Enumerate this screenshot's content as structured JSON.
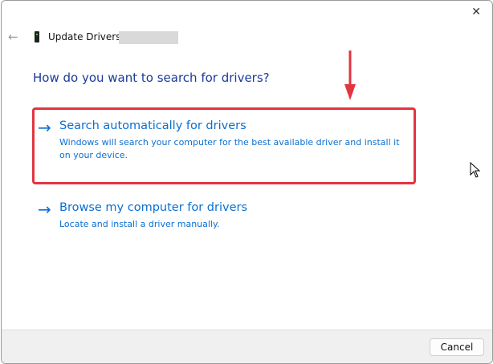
{
  "window": {
    "title": "Update Drivers -",
    "close_icon": "close-icon",
    "back_icon": "back-arrow-icon"
  },
  "heading": "How do you want to search for drivers?",
  "options": [
    {
      "label": "Search automatically for drivers",
      "description": "Windows will search your computer for the best available driver and install it on your device."
    },
    {
      "label": "Browse my computer for drivers",
      "description": "Locate and install a driver manually."
    }
  ],
  "footer": {
    "cancel_label": "Cancel"
  },
  "colors": {
    "accent": "#0b6fd0",
    "highlight": "#e2353f",
    "heading": "#1a3a9a"
  }
}
